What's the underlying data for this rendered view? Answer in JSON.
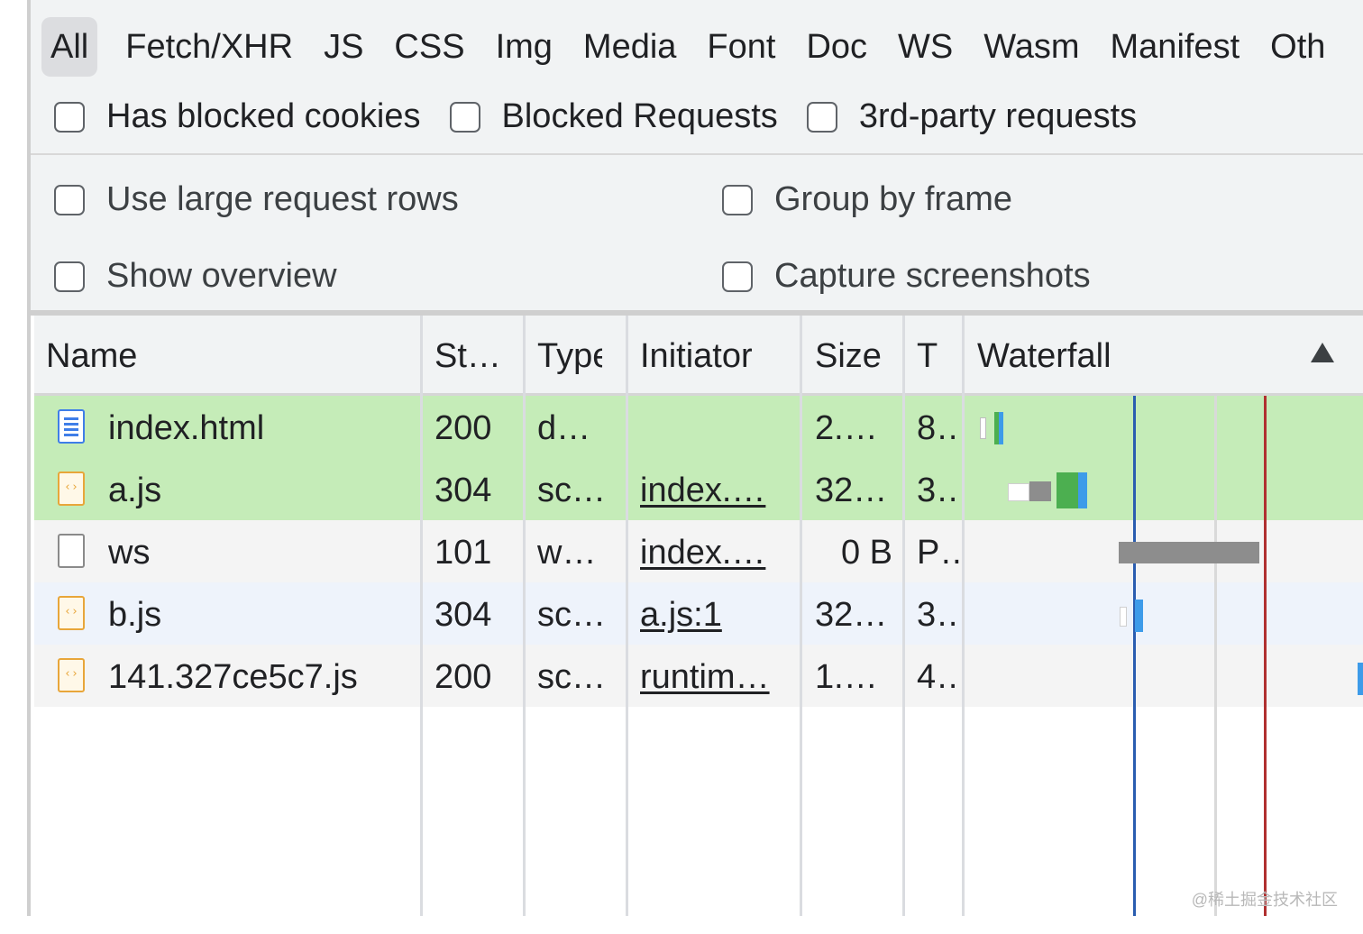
{
  "filters": {
    "types": [
      "All",
      "Fetch/XHR",
      "JS",
      "CSS",
      "Img",
      "Media",
      "Font",
      "Doc",
      "WS",
      "Wasm",
      "Manifest",
      "Oth"
    ],
    "active_type": "All",
    "checkboxes": [
      {
        "label": "Has blocked cookies",
        "checked": false
      },
      {
        "label": "Blocked Requests",
        "checked": false
      },
      {
        "label": "3rd-party requests",
        "checked": false
      }
    ]
  },
  "settings": {
    "large_rows": {
      "label": "Use large request rows",
      "checked": false
    },
    "show_overview": {
      "label": "Show overview",
      "checked": false
    },
    "group_by_frame": {
      "label": "Group by frame",
      "checked": false
    },
    "capture_screenshots": {
      "label": "Capture screenshots",
      "checked": false
    }
  },
  "table": {
    "columns": [
      "Name",
      "St…",
      "Type",
      "Initiator",
      "Size",
      "T",
      "Waterfall"
    ],
    "sort_indicator": "ascending",
    "rows": [
      {
        "name": "index.html",
        "icon": "document-icon",
        "status": "200",
        "type": "d…",
        "initiator": "",
        "size": "2.…",
        "time": "8…"
      },
      {
        "name": "a.js",
        "icon": "script-icon",
        "status": "304",
        "type": "sc…",
        "initiator": "index.…",
        "size": "32…",
        "time": "3…"
      },
      {
        "name": "ws",
        "icon": "websocket-icon",
        "status": "101",
        "type": "w…",
        "initiator": "index.…",
        "size": "0 B",
        "time": "P…"
      },
      {
        "name": "b.js",
        "icon": "script-icon",
        "status": "304",
        "type": "sc…",
        "initiator": "a.js:1",
        "size": "32…",
        "time": "3…"
      },
      {
        "name": "141.327ce5c7.js",
        "icon": "script-icon",
        "status": "200",
        "type": "sc…",
        "initiator": "runtim…",
        "size": "1.…",
        "time": "4…"
      }
    ]
  },
  "colors": {
    "selected_row": "#c5ecb8",
    "dom_content_loaded_line": "#2a5db0",
    "load_line": "#b03030",
    "waiting_bar": "#4caf50",
    "download_bar": "#3d9be9",
    "stalled_bar": "#8d8d8d"
  },
  "watermark": "@稀土掘金技术社区"
}
